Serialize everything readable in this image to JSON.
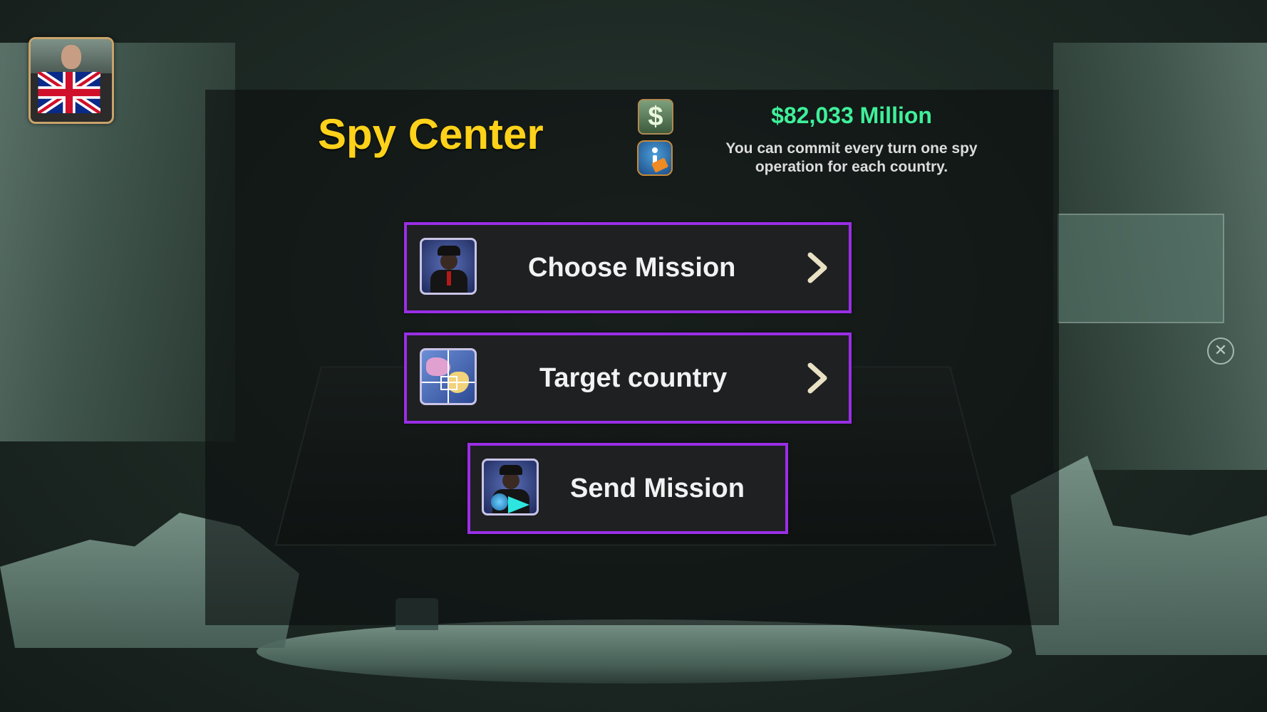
{
  "screen": {
    "title": "Spy Center",
    "money": "$82,033 Million",
    "note": "You can commit every turn one spy operation for each country.",
    "money_icon_glyph": "$"
  },
  "menu": {
    "choose_mission": "Choose Mission",
    "target_country": "Target country",
    "send_mission": "Send Mission"
  },
  "icons": {
    "player": "uk-flag-icon",
    "money": "dollar-icon",
    "info": "info-icon",
    "choose": "spy-agent-icon",
    "target": "map-target-icon",
    "send": "send-spy-icon",
    "arrow": "chevron-right-icon",
    "close": "close-icon"
  },
  "colors": {
    "title": "#ffd21a",
    "money": "#3ff09a",
    "button_border": "#9a2ee6",
    "button_bg": "#1f2022"
  }
}
